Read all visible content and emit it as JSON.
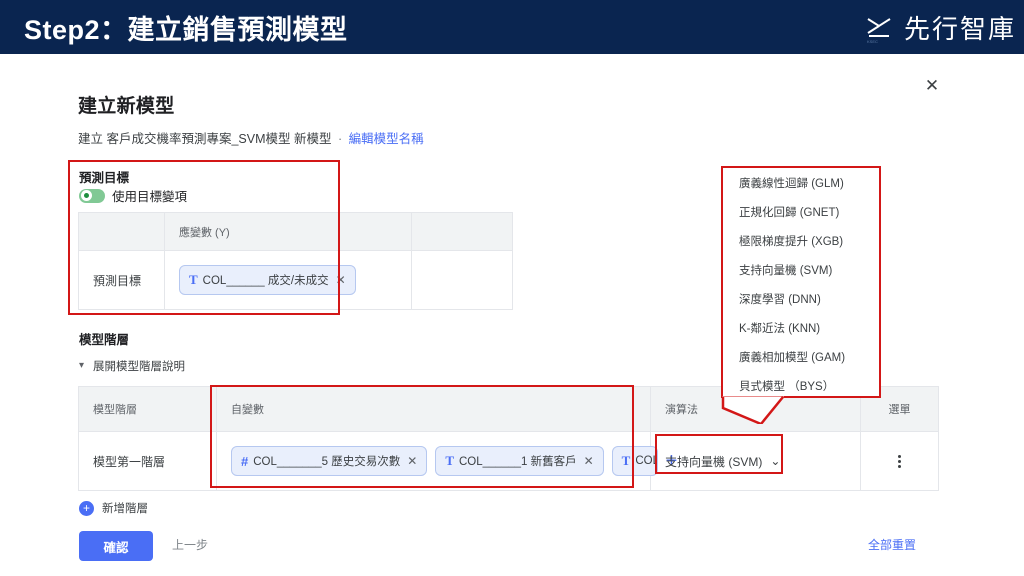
{
  "header": {
    "title": "Step2：建立銷售預測模型",
    "brand_text": "先行智庫",
    "brand_icon": "logo-mark-icon",
    "bg_color": "#0a2550"
  },
  "dialog": {
    "close_icon": "close-icon",
    "title": "建立新模型",
    "subtitle_prefix": "建立 客戶成交機率預測專案_SVM模型 新模型",
    "subtitle_separator": "·",
    "subtitle_link": "編輯模型名稱"
  },
  "prediction_target": {
    "section_title": "預測目標",
    "toggle_label": "使用目標變項",
    "toggle_on": true,
    "toggle_color": "#81c995",
    "table": {
      "headers": [
        "",
        "應變數 (Y)",
        ""
      ],
      "row_label": "預測目標",
      "chip": {
        "type_icon": "text-type-icon",
        "type_glyph": "T",
        "label": "COL______ 成交/未成交",
        "remove_icon": "close-icon",
        "remove_glyph": "✕"
      }
    }
  },
  "model_tier": {
    "section_title": "模型階層",
    "expander_label": "展開模型階層說明",
    "expander_icon": "chevron-down-icon",
    "table": {
      "headers": [
        "模型階層",
        "自變數",
        "演算法",
        "選單"
      ],
      "row": {
        "tier_label": "模型第一階層",
        "chips": [
          {
            "type_glyph": "#",
            "type_icon": "number-type-icon",
            "label": "COL_______5 歷史交易次數",
            "remove_glyph": "✕"
          },
          {
            "type_glyph": "T",
            "type_icon": "text-type-icon",
            "label": "COL______1 新舊客戶",
            "remove_glyph": "✕"
          },
          {
            "type_glyph": "T",
            "type_icon": "text-type-icon",
            "label": "COL_",
            "remove_glyph": ""
          }
        ],
        "add_variable_glyph": "+",
        "algorithm_value": "支持向量機 (SVM)",
        "algorithm_caret": "⌄",
        "menu_icon": "kebab-menu-icon"
      }
    }
  },
  "algorithm_dropdown": {
    "options": [
      "廣義線性迴歸 (GLM)",
      "正規化回歸 (GNET)",
      "極限梯度提升 (XGB)",
      "支持向量機 (SVM)",
      "深度學習 (DNN)",
      "K-鄰近法 (KNN)",
      "廣義相加模型 (GAM)",
      "貝式模型 （BYS）"
    ],
    "border_color": "#d31717"
  },
  "footer": {
    "add_tier_label": "新增階層",
    "add_tier_icon": "plus-circle-icon",
    "confirm_label": "確認",
    "back_label": "上一步",
    "reset_label": "全部重置",
    "primary_color": "#4a6ef5"
  },
  "highlights": {
    "color": "#d31717",
    "boxes": [
      "prediction-target",
      "independent-variables",
      "algorithm-select",
      "algorithm-dropdown"
    ]
  }
}
